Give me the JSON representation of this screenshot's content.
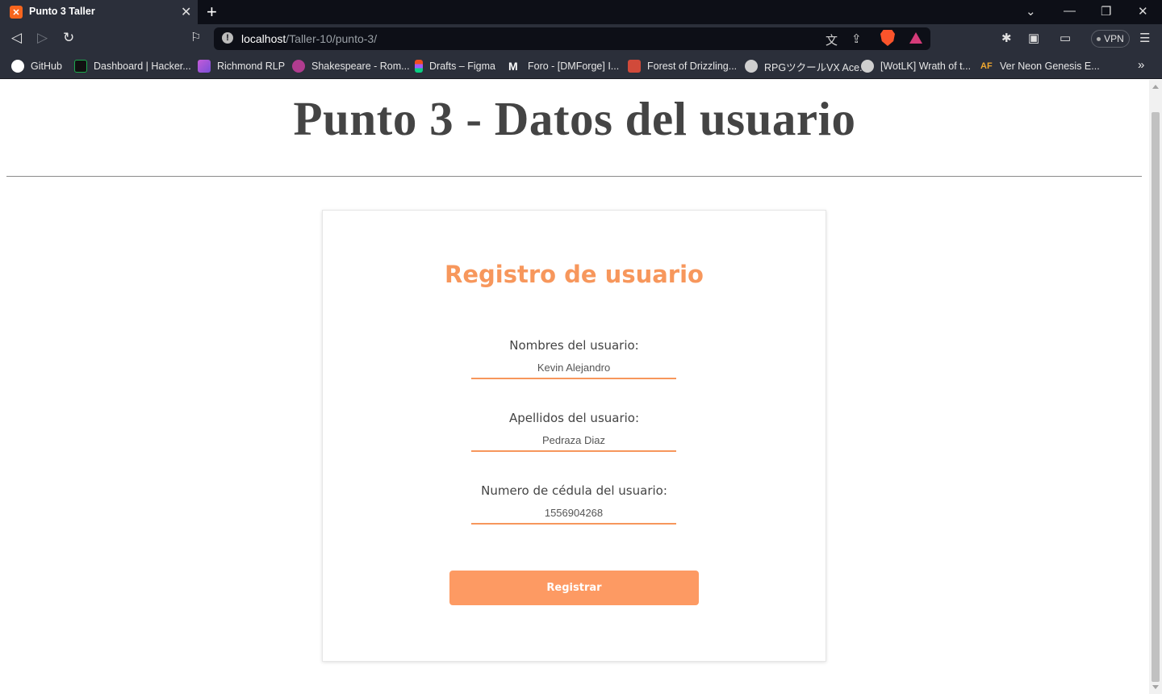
{
  "browser": {
    "tab": {
      "title": "Punto 3 Taller",
      "favicon": "xampp-icon"
    },
    "url": {
      "host": "localhost",
      "path": "/Taller-10/punto-3/"
    },
    "vpn_label": "VPN",
    "bookmarks": [
      {
        "label": "GitHub",
        "icon": "github-icon",
        "color": "#ffffff"
      },
      {
        "label": "Dashboard | Hacker...",
        "icon": "hackerrank-icon",
        "color": "#1ba94c"
      },
      {
        "label": "Richmond RLP",
        "icon": "richmond-icon",
        "color": "#c45bd8"
      },
      {
        "label": "Shakespeare - Rom...",
        "icon": "shakespeare-icon",
        "color": "#b03c8f"
      },
      {
        "label": "Drafts – Figma",
        "icon": "figma-icon",
        "color": "#f24e1e"
      },
      {
        "label": "Foro - [DMForge] I...",
        "icon": "forum-icon",
        "color": "#ffffff"
      },
      {
        "label": "Forest of Drizzling...",
        "icon": "forest-icon",
        "color": "#d14a3a"
      },
      {
        "label": "RPGツクールVX Ace...",
        "icon": "globe-icon",
        "color": "#cfcfcf"
      },
      {
        "label": "[WotLK] Wrath of t...",
        "icon": "globe-icon",
        "color": "#cfcfcf"
      },
      {
        "label": "Ver Neon Genesis E...",
        "icon": "animeflv-icon",
        "color": "#f0a830"
      }
    ]
  },
  "page": {
    "title": "Punto 3 - Datos del usuario",
    "form": {
      "heading": "Registro de usuario",
      "fields": [
        {
          "label": "Nombres del usuario:",
          "value": "Kevin Alejandro"
        },
        {
          "label": "Apellidos del usuario:",
          "value": "Pedraza Diaz"
        },
        {
          "label": "Numero de cédula del usuario:",
          "value": "1556904268"
        }
      ],
      "submit_label": "Registrar"
    }
  },
  "colors": {
    "accent": "#f7975c",
    "button": "#fd9a63",
    "title": "#444444"
  }
}
